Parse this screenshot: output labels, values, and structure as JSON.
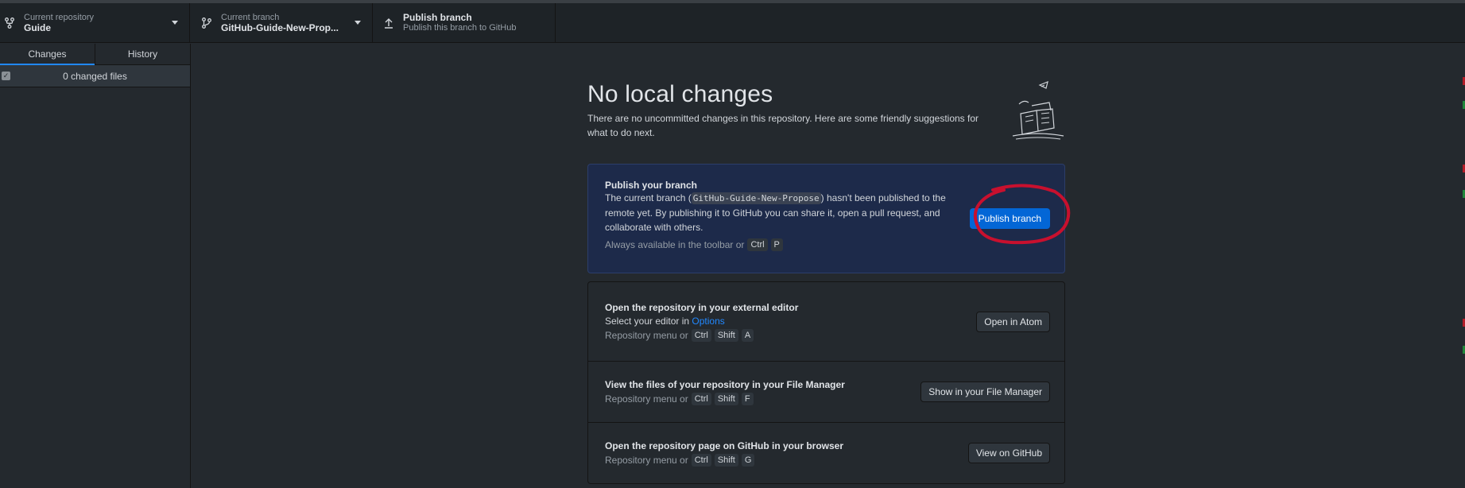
{
  "toolbar": {
    "repository": {
      "label": "Current repository",
      "value": "Guide"
    },
    "branch": {
      "label": "Current branch",
      "value": "GitHub-Guide-New-Prop..."
    },
    "publish": {
      "label": "Publish branch",
      "sub": "Publish this branch to GitHub"
    }
  },
  "sidebar": {
    "tabs": [
      {
        "label": "Changes"
      },
      {
        "label": "History"
      }
    ],
    "changes_count": "0 changed files"
  },
  "main": {
    "title": "No local changes",
    "subtitle": "There are no uncommitted changes in this repository. Here are some friendly suggestions for what to do next.",
    "publish_card": {
      "title": "Publish your branch",
      "desc_before": "The current branch (",
      "branch_code": "GitHub-Guide-New-Propose",
      "desc_after": ") hasn't been published to the remote yet. By publishing it to GitHub you can share it, open a pull request, and collaborate with others.",
      "hint_text": "Always available in the toolbar or",
      "keys": [
        "Ctrl",
        "P"
      ],
      "button": "Publish branch"
    },
    "actions": [
      {
        "title": "Open the repository in your external editor",
        "desc_before": "Select your editor in ",
        "link": "Options",
        "hint_text": "Repository menu or",
        "keys": [
          "Ctrl",
          "Shift",
          "A"
        ],
        "button": "Open in Atom"
      },
      {
        "title": "View the files of your repository in your File Manager",
        "hint_text": "Repository menu or",
        "keys": [
          "Ctrl",
          "Shift",
          "F"
        ],
        "button": "Show in your File Manager"
      },
      {
        "title": "Open the repository page on GitHub in your browser",
        "hint_text": "Repository menu or",
        "keys": [
          "Ctrl",
          "Shift",
          "G"
        ],
        "button": "View on GitHub"
      }
    ]
  },
  "colors": {
    "accent": "#0366d6",
    "annotation_red": "#c8102e",
    "publish_card_bg": "#1d2a4a"
  },
  "icons": {
    "repository": "repo-fork-icon",
    "branch": "git-branch-icon",
    "publish": "upload-arrow-icon",
    "illustration": "paper-stack-illustration"
  }
}
